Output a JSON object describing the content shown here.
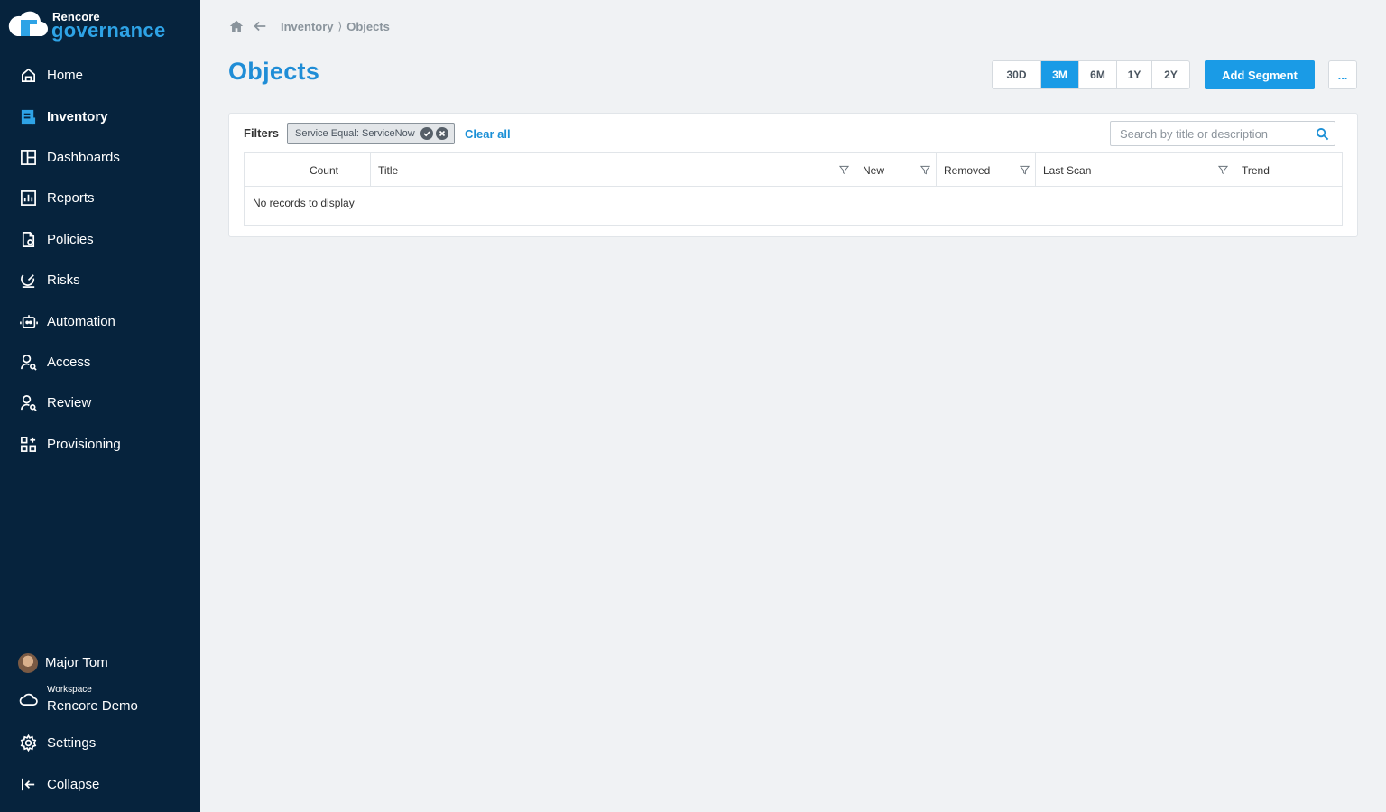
{
  "brand": {
    "top": "Rencore",
    "main": "governance"
  },
  "nav": {
    "items": [
      {
        "label": "Home",
        "icon": "home-icon"
      },
      {
        "label": "Inventory",
        "icon": "inventory-icon",
        "active": true
      },
      {
        "label": "Dashboards",
        "icon": "dashboard-icon"
      },
      {
        "label": "Reports",
        "icon": "reports-icon"
      },
      {
        "label": "Policies",
        "icon": "policies-icon"
      },
      {
        "label": "Risks",
        "icon": "risks-icon"
      },
      {
        "label": "Automation",
        "icon": "robot-icon"
      },
      {
        "label": "Access",
        "icon": "user-search-icon"
      },
      {
        "label": "Review",
        "icon": "user-review-icon"
      },
      {
        "label": "Provisioning",
        "icon": "provisioning-icon"
      }
    ],
    "user": "Major Tom",
    "workspace_caption": "Workspace",
    "workspace_name": "Rencore Demo",
    "settings": "Settings",
    "collapse": "Collapse"
  },
  "breadcrumb": {
    "parent": "Inventory",
    "separator": "⟩",
    "current": "Objects"
  },
  "page": {
    "title": "Objects"
  },
  "toolbar": {
    "ranges": [
      "30D",
      "3M",
      "6M",
      "1Y",
      "2Y"
    ],
    "active_range": "3M",
    "add_segment": "Add Segment",
    "more": "..."
  },
  "filters": {
    "label": "Filters",
    "chip": "Service Equal: ServiceNow",
    "clear_all": "Clear all"
  },
  "search": {
    "placeholder": "Search by title or description"
  },
  "grid": {
    "columns": [
      "Count",
      "Title",
      "New",
      "Removed",
      "Last Scan",
      "Trend"
    ],
    "empty_message": "No records to display"
  },
  "colors": {
    "sidebar": "#06233d",
    "accent": "#1a9be6",
    "title": "#1f8dd6"
  }
}
